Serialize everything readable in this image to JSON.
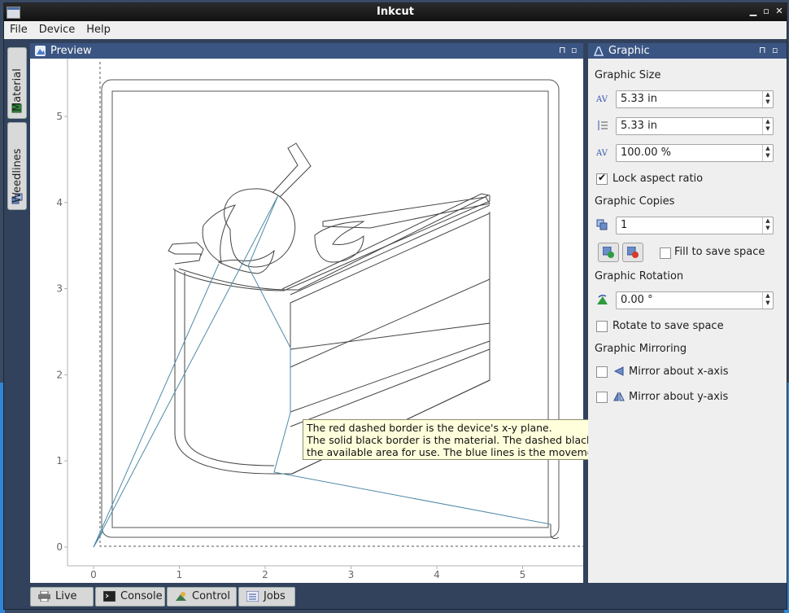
{
  "window": {
    "title": "Inkcut"
  },
  "menu": [
    "File",
    "Device",
    "Help"
  ],
  "side_tabs": [
    "Material",
    "Weedlines"
  ],
  "preview": {
    "title": "Preview",
    "x_ticks": [
      "0",
      "1",
      "2",
      "3",
      "4",
      "5"
    ],
    "y_ticks": [
      "0",
      "1",
      "2",
      "3",
      "4",
      "5"
    ],
    "tooltip": "The red dashed border is the device's x-y plane.\nThe solid black border is the material. The dashed black border is the available area for use. The blue lines is the movement path."
  },
  "graphic": {
    "title": "Graphic",
    "size_label": "Graphic Size",
    "width": "5.33 in",
    "height": "5.33 in",
    "scale": "100.00 %",
    "lock_aspect": {
      "label": "Lock aspect ratio",
      "checked": true
    },
    "copies_label": "Graphic Copies",
    "copies": "1",
    "fill_to_save": {
      "label": "Fill to save space",
      "checked": false
    },
    "rotation_label": "Graphic Rotation",
    "rotation": "0.00 °",
    "rotate_to_save": {
      "label": "Rotate to save space",
      "checked": false
    },
    "mirroring_label": "Graphic Mirroring",
    "mirror_x": {
      "label": "Mirror about x-axis",
      "checked": false
    },
    "mirror_y": {
      "label": "Mirror about y-axis",
      "checked": false
    }
  },
  "bottom_tabs": [
    "Live",
    "Console",
    "Control",
    "Jobs"
  ],
  "colors": {
    "header": "#3b5582",
    "frame": "#32425c",
    "path": "#4e8aa6"
  }
}
